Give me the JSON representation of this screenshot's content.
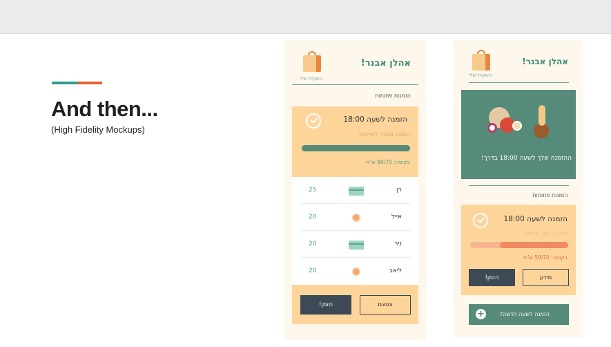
{
  "slide": {
    "title": "And then...",
    "subtitle": "(High Fidelity Mockups)"
  },
  "colors": {
    "teal": "#2a9d8f",
    "orange": "#e0622a",
    "green": "#568a79",
    "peach": "#fdd59b",
    "dark": "#3d4a55"
  },
  "mid_phone": {
    "greeting": "אהלן אבנר!",
    "bag_label": "השקית שלי",
    "section": "הזמנות פתוחות",
    "order": {
      "title": "הזמנה לשעה 18:00",
      "status": "הזמנה מוכנה לשילוח!",
      "progress": 1.0,
      "basket": "בקופה: 90/70 ש\"ח"
    },
    "rows": [
      {
        "name": "רן",
        "amount": "25",
        "payment_icon": "credit-card-icon"
      },
      {
        "name": "אייל",
        "amount": "20",
        "payment_icon": "coin-icon"
      },
      {
        "name": "ניר",
        "amount": "20",
        "payment_icon": "credit-card-icon"
      },
      {
        "name": "ליאב",
        "amount": "20",
        "payment_icon": "coin-icon"
      }
    ],
    "buttons": {
      "order": "הזמן!",
      "join": "צטצם"
    }
  },
  "right_phone": {
    "greeting": "אהלן אבנר!",
    "bag_label": "השקית שלי",
    "hero_message": "ההזמנה שלך לשעה 18:00 בדרך!",
    "section": "הזמנות פתוחות",
    "order": {
      "title": "הזמנה לשעה 18:00",
      "status": "מוכנה לעוד אנשים",
      "progress": 0.7,
      "basket": "בקופה: 50/70 ש\"ח"
    },
    "buttons": {
      "order": "הזמן!",
      "info": "מידע"
    },
    "new_order": "הזמנה לשעה חדשה?"
  }
}
